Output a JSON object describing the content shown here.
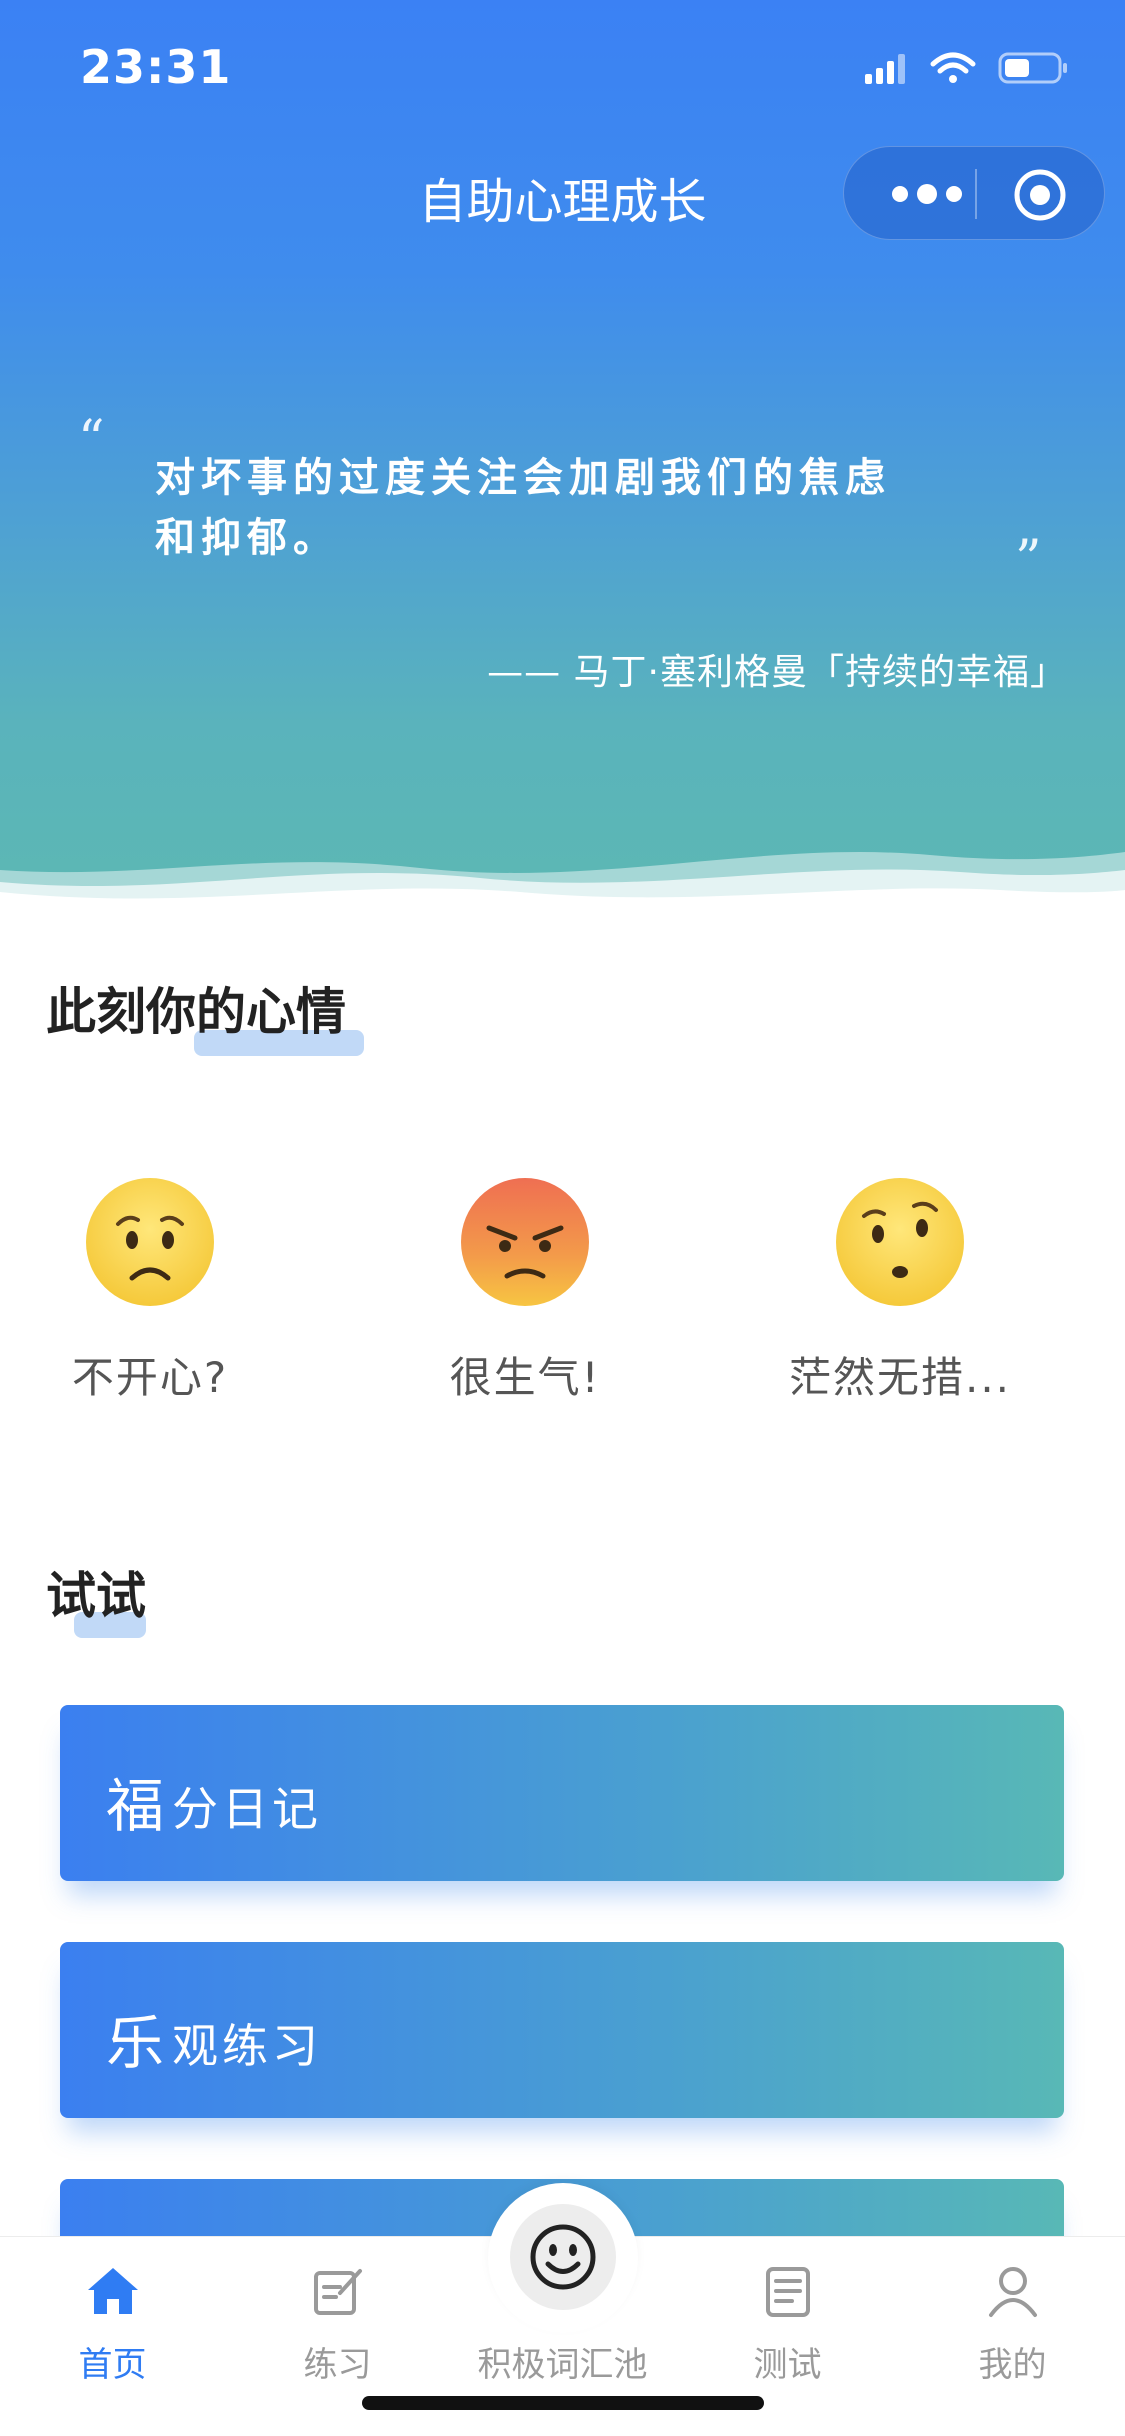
{
  "status_bar": {
    "time": "23:31"
  },
  "header": {
    "title": "自助心理成长"
  },
  "capsule": {
    "more_icon": "more-dots-icon",
    "close_icon": "target-circle-icon"
  },
  "quote": {
    "open_mark": "“",
    "close_mark": "”",
    "text_line1": "对坏事的过度关注会加剧我们的焦虑",
    "text_line2": "和抑郁。",
    "source": "—— 马丁·塞利格曼「持续的幸福」"
  },
  "mood_section": {
    "title": "此刻你的心情",
    "items": [
      {
        "label": "不开心?",
        "icon": "worried-face-icon"
      },
      {
        "label": "很生气!",
        "icon": "angry-face-icon"
      },
      {
        "label": "茫然无措...",
        "icon": "confused-face-icon"
      }
    ]
  },
  "try_section": {
    "title": "试试",
    "cards": [
      {
        "big": "福",
        "rest": "分日记"
      },
      {
        "big": "乐",
        "rest": "观练习"
      }
    ]
  },
  "tabbar": {
    "items": [
      {
        "label": "首页",
        "icon": "home-icon",
        "active": true
      },
      {
        "label": "练习",
        "icon": "edit-note-icon"
      },
      {
        "label": "积极词汇池",
        "icon": "smile-icon"
      },
      {
        "label": "测试",
        "icon": "document-list-icon"
      },
      {
        "label": "我的",
        "icon": "user-icon"
      }
    ]
  },
  "colors": {
    "accent": "#2f7cf3",
    "hero_top": "#3b81f4",
    "hero_bottom": "#5cb8b3",
    "card_left": "#3b7ff0",
    "card_right": "#58b8b6"
  }
}
